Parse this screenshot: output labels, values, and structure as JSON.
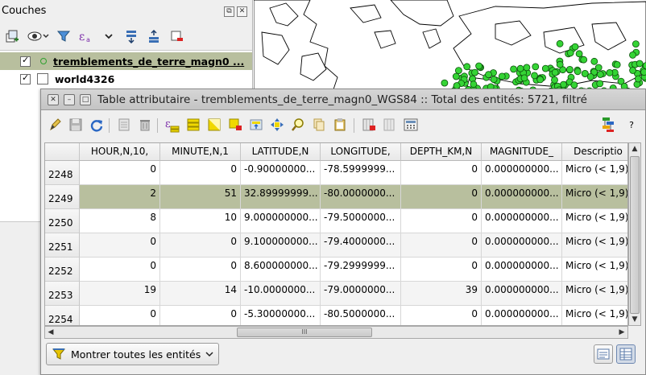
{
  "layers_panel": {
    "title": "Couches",
    "icons": [
      "add-group-icon",
      "eye-icon",
      "filter-icon",
      "expression-filter-icon",
      "chevron-down-icon",
      "expand-all-icon",
      "collapse-all-icon",
      "remove-layer-icon"
    ],
    "layers": [
      {
        "name": "tremblements_de_terre_magn0 ...",
        "checked": true,
        "symbol": "point",
        "selected": true
      },
      {
        "name": "world4326",
        "checked": true,
        "symbol": "polygon",
        "selected": false
      }
    ]
  },
  "window": {
    "title": "Table attributaire - tremblements_de_terre_magn0_WGS84 :: Total des entités: 5721, filtré"
  },
  "toolbar": {
    "icons": [
      "edit-pencil-icon",
      "save-edits-icon",
      "reload-icon",
      "add-feature-icon",
      "delete-feature-icon",
      "expression-select-icon",
      "select-all-icon",
      "invert-selection-icon",
      "deselect-icon",
      "move-selection-top-icon",
      "pan-to-selection-icon",
      "zoom-to-selection-icon",
      "copy-icon",
      "paste-icon",
      "delete-field-icon",
      "new-field-icon",
      "field-calculator-icon",
      "conditional-format-icon",
      "help-icon"
    ],
    "help_label": "?"
  },
  "table": {
    "columns": [
      "HOUR,N,10,",
      "MINUTE,N,1",
      "LATITUDE,N",
      "LONGITUDE,",
      "DEPTH_KM,N",
      "MAGNITUDE_",
      "Descriptio"
    ],
    "rows": [
      {
        "id": "2248",
        "cells": [
          "0",
          "0",
          "-0.90000000...",
          "-78.5999999...",
          "0",
          "0.000000000...",
          "Micro (< 1,9)"
        ]
      },
      {
        "id": "2249",
        "cells": [
          "2",
          "51",
          "32.89999999...",
          "-80.0000000...",
          "0",
          "0.000000000...",
          "Micro (< 1,9)"
        ],
        "selected": true
      },
      {
        "id": "2250",
        "cells": [
          "8",
          "10",
          "9.000000000...",
          "-79.5000000...",
          "0",
          "0.000000000...",
          "Micro (< 1,9)"
        ]
      },
      {
        "id": "2251",
        "cells": [
          "0",
          "0",
          "9.100000000...",
          "-79.4000000...",
          "0",
          "0.000000000...",
          "Micro (< 1,9)"
        ]
      },
      {
        "id": "2252",
        "cells": [
          "0",
          "0",
          "8.600000000...",
          "-79.2999999...",
          "0",
          "0.000000000...",
          "Micro (< 1,9)"
        ]
      },
      {
        "id": "2253",
        "cells": [
          "19",
          "14",
          "-10.0000000...",
          "-79.0000000...",
          "39",
          "0.000000000...",
          "Micro (< 1,9)"
        ]
      },
      {
        "id": "2254",
        "cells": [
          "0",
          "0",
          "-5.30000000...",
          "-80.5000000...",
          "0",
          "0.000000000...",
          "Micro (< 1,9)"
        ]
      }
    ],
    "scroll_grip": "III"
  },
  "footer": {
    "filter_label": "Montrer toutes les entités",
    "view_modes": [
      "form-view-icon",
      "table-view-icon"
    ]
  },
  "colors": {
    "selection": "#b8bf9e",
    "point_fill": "#35d435",
    "point_stroke": "#0b4f0b"
  }
}
